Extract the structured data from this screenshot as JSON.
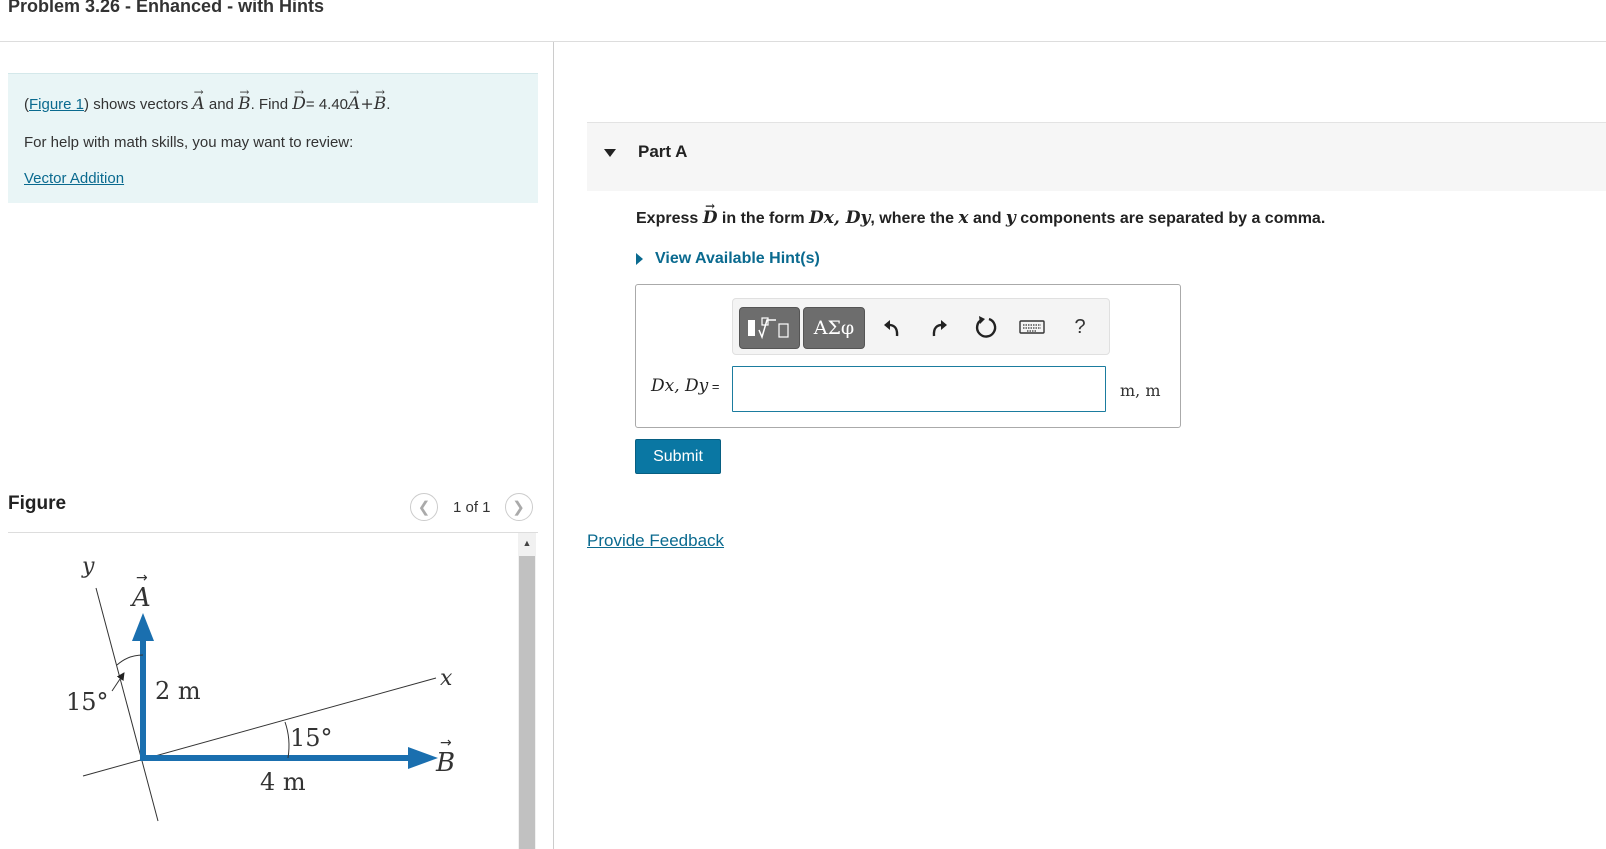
{
  "header": {
    "title": "Problem 3.26 - Enhanced - with Hints"
  },
  "intro": {
    "figure_link": "Figure 1",
    "t1": "shows vectors",
    "vec_a": "A",
    "t_and": "and",
    "vec_b": "B",
    "t_find": ". Find",
    "vec_d": "D",
    "eq": "= 4.40",
    "plus": "+",
    "period": ".",
    "help_text": "For help with math skills, you may want to review:",
    "review_link": "Vector Addition"
  },
  "figure_panel": {
    "heading": "Figure",
    "pager_text": "1 of 1",
    "diagram": {
      "axis_y": "y",
      "axis_x": "x",
      "vec_a": "A",
      "vec_b": "B",
      "angle_left": "15°",
      "angle_right": "15°",
      "len_a": "2 m",
      "len_b": "4 m",
      "color": "#1a6faf"
    }
  },
  "part_a": {
    "label": "Part A",
    "instruction": {
      "t1": "Express",
      "vec": "D",
      "t2": "in the form",
      "form": "Dx, Dy",
      "t3": ", where the",
      "var_x": "x",
      "t4": "and",
      "var_y": "y",
      "t5": "components are separated by a comma."
    },
    "hints": "View Available Hint(s)",
    "toolbar": {
      "greek": "ΑΣφ",
      "help": "?"
    },
    "answer": {
      "label": "Dx, Dy",
      "eq": " =",
      "value": "",
      "units": "m, m"
    },
    "submit": "Submit"
  },
  "feedback": "Provide Feedback",
  "colors": {
    "accent": "#0a77a3",
    "link": "#0a6a8f",
    "intro_bg": "#e9f5f6",
    "vector": "#1a6faf"
  }
}
